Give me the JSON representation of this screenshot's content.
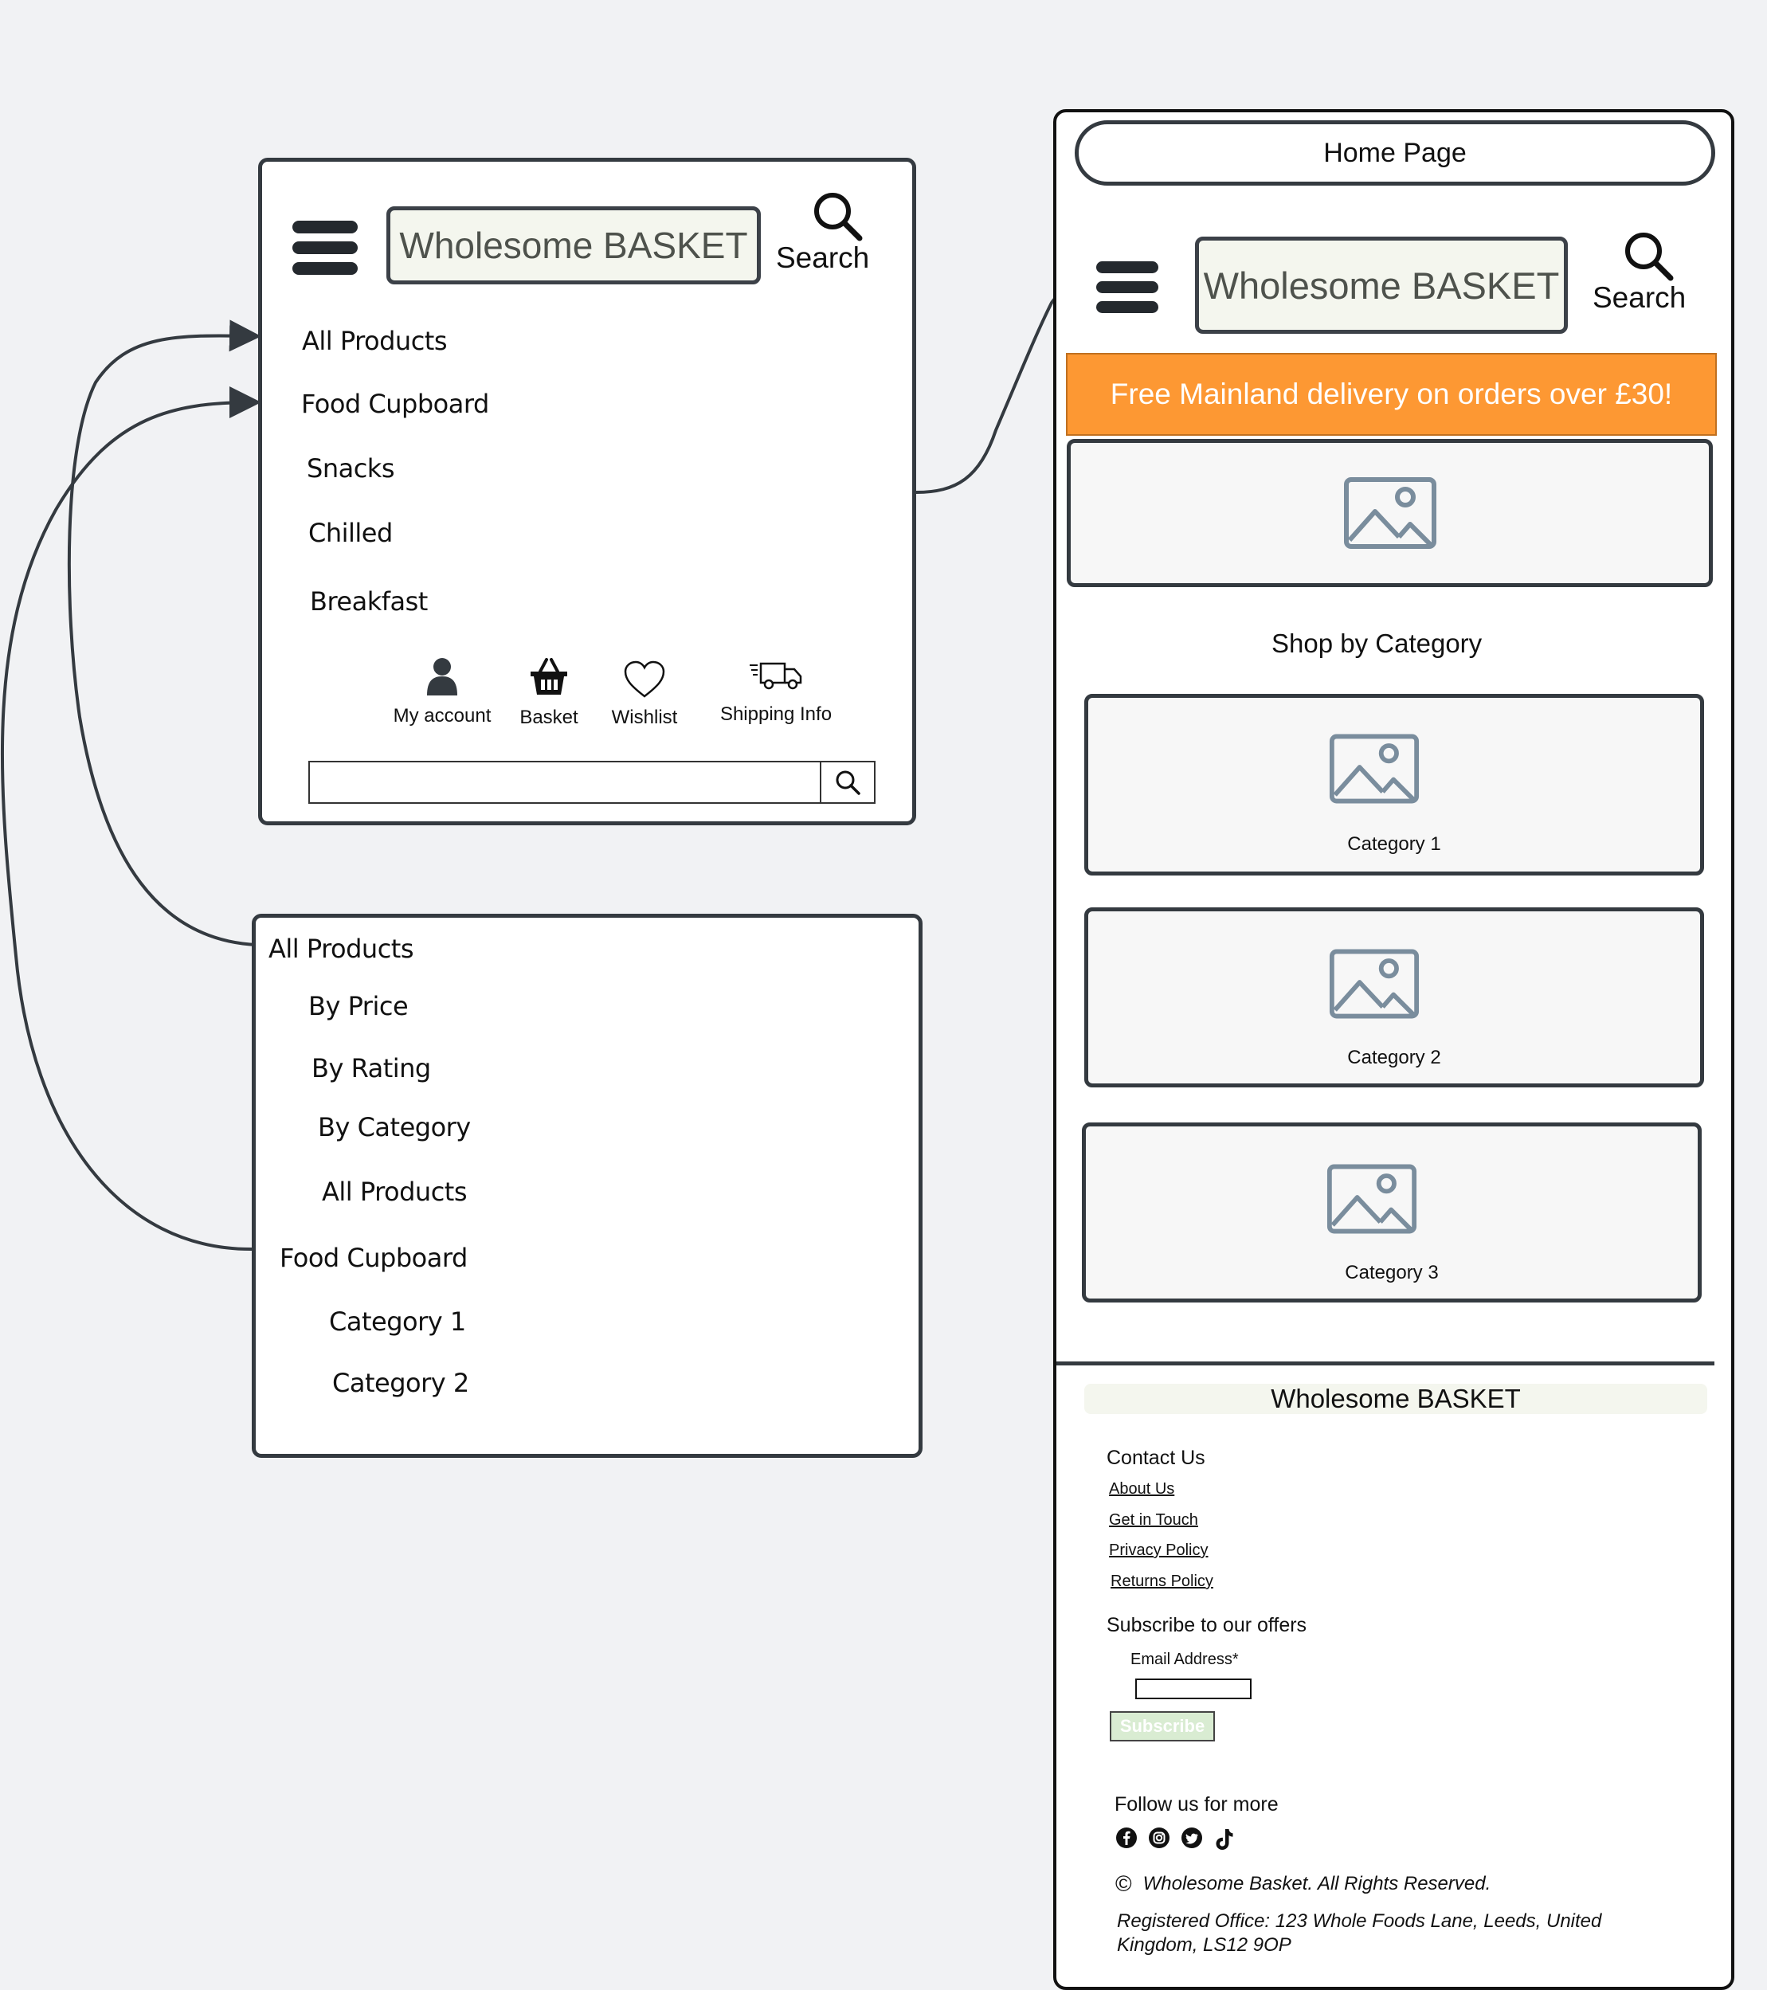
{
  "nav_menu": {
    "logo": "Wholesome BASKET",
    "search_label": "Search",
    "items": [
      "All Products",
      "Food Cupboard",
      "Snacks",
      "Chilled",
      "Breakfast"
    ],
    "icons": [
      {
        "label": "My account",
        "icon": "user-icon"
      },
      {
        "label": "Basket",
        "icon": "basket-icon"
      },
      {
        "label": "Wishlist",
        "icon": "heart-icon"
      },
      {
        "label": "Shipping Info",
        "icon": "truck-icon"
      }
    ],
    "search_placeholder": ""
  },
  "submenu": {
    "items": [
      "All Products",
      "By Price",
      "By Rating",
      "By Category",
      "All Products",
      "Food Cupboard",
      "Category 1",
      "Category 2"
    ]
  },
  "home_page": {
    "title": "Home Page",
    "logo": "Wholesome BASKET",
    "search_label": "Search",
    "banner": "Free Mainland delivery on orders over £30!",
    "shop_by_category": "Shop by Category",
    "categories": [
      "Category 1",
      "Category 2",
      "Category 3"
    ],
    "footer": {
      "brand": "Wholesome BASKET",
      "contact_heading": "Contact Us",
      "links": [
        "About Us",
        "Get in Touch",
        "Privacy Policy",
        "Returns Policy"
      ],
      "subscribe_heading": "Subscribe to our offers",
      "email_label": "Email Address*",
      "email_value": "",
      "subscribe_button": "Subscribe",
      "follow_heading": "Follow us for more",
      "social_icons": [
        "facebook-icon",
        "instagram-icon",
        "twitter-icon",
        "tiktok-icon"
      ],
      "copyright_symbol": "©",
      "copyright": "Wholesome Basket. All Rights Reserved.",
      "address": "Registered Office: 123 Whole Foods Lane, Leeds, United Kingdom, LS12 9OP"
    }
  },
  "colors": {
    "background": "#f1f2f4",
    "frame_border": "#343a40",
    "banner": "#fd9833",
    "logo_fill": "#f4f6ee",
    "image_icon": "#7a8d9d",
    "subscribe_fill": "#d9ecd2"
  }
}
